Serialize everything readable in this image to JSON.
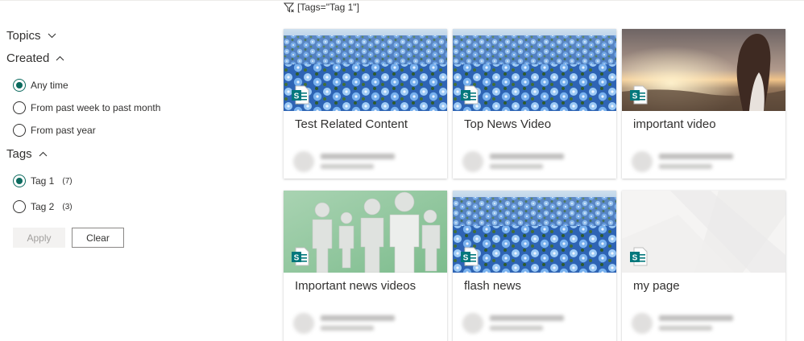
{
  "filter": {
    "label": "[Tags=\"Tag 1\"]"
  },
  "refiner": {
    "topics": {
      "label": "Topics"
    },
    "created": {
      "label": "Created",
      "options": [
        {
          "label": "Any time",
          "selected": true
        },
        {
          "label": "From past week to past month",
          "selected": false
        },
        {
          "label": "From past year",
          "selected": false
        }
      ]
    },
    "tags": {
      "label": "Tags",
      "options": [
        {
          "label": "Tag 1",
          "count": "(7)",
          "selected": true
        },
        {
          "label": "Tag 2",
          "count": "(3)",
          "selected": false
        }
      ]
    },
    "apply_label": "Apply",
    "clear_label": "Clear"
  },
  "results": [
    {
      "title": "Test Related Content",
      "thumbnail": "flower-field"
    },
    {
      "title": "Top News Video",
      "thumbnail": "flower-field"
    },
    {
      "title": "important video",
      "thumbnail": "sunset-woman"
    },
    {
      "title": "Important news videos",
      "thumbnail": "paper-figures"
    },
    {
      "title": "flash news",
      "thumbnail": "flower-field"
    },
    {
      "title": "my page",
      "thumbnail": "placeholder"
    }
  ],
  "colors": {
    "accent": "#0b6a5e",
    "sharepoint": "#03787c"
  }
}
